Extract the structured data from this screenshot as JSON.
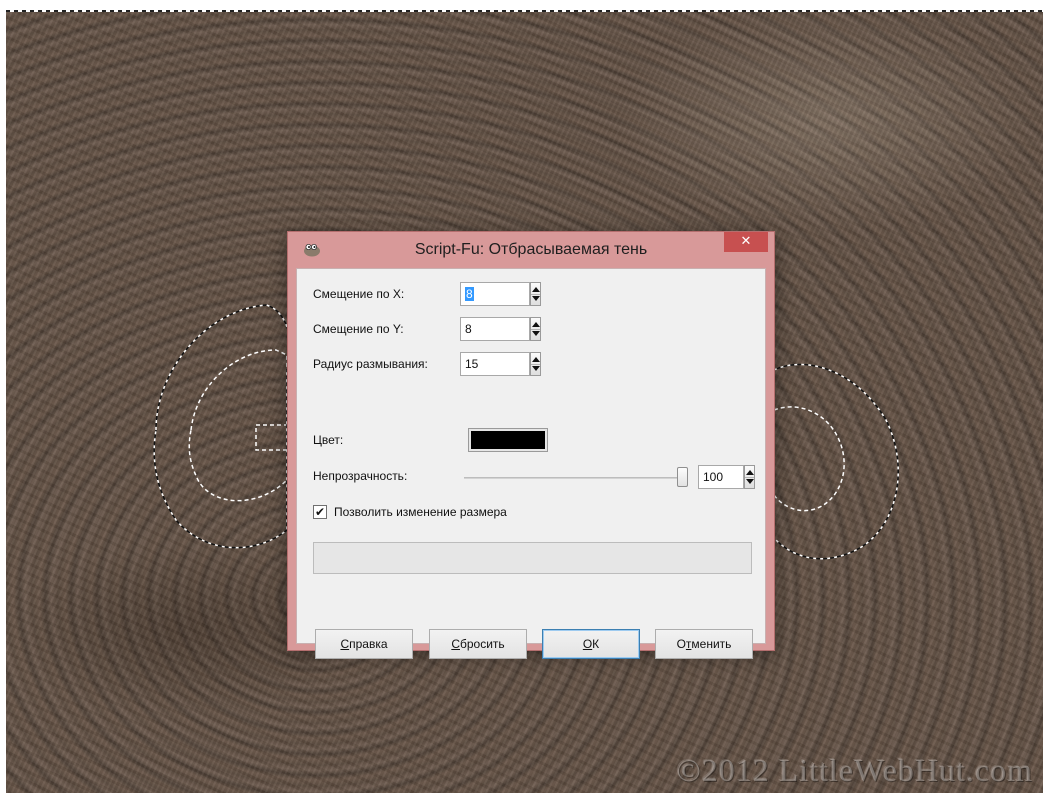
{
  "window": {
    "title": "Script-Fu: Отбрасываемая тень",
    "close_label": "✕"
  },
  "fields": {
    "offset_x": {
      "label": "Смещение по X:",
      "value": "8"
    },
    "offset_y": {
      "label": "Смещение по Y:",
      "value": "8"
    },
    "blur_radius": {
      "label": "Радиус размывания:",
      "value": "15"
    },
    "color": {
      "label": "Цвет:",
      "value": "#000000"
    },
    "opacity": {
      "label": "Непрозрачность:",
      "value": "100"
    }
  },
  "checkbox": {
    "label": "Позволить изменение размера",
    "checked": true,
    "mark": "✔"
  },
  "buttons": {
    "help": {
      "mnemonic": "С",
      "rest": "правка"
    },
    "reset": {
      "mnemonic": "С",
      "rest": "бросить"
    },
    "ok": {
      "mnemonic": "О",
      "rest": "К"
    },
    "cancel": {
      "before": "О",
      "mnemonic": "т",
      "rest": "менить"
    }
  },
  "watermark": "©2012 LittleWebHut.com",
  "colors": {
    "dialog_frame": "#d89999",
    "close_button": "#c75050",
    "selection_highlight": "#3399ff"
  }
}
